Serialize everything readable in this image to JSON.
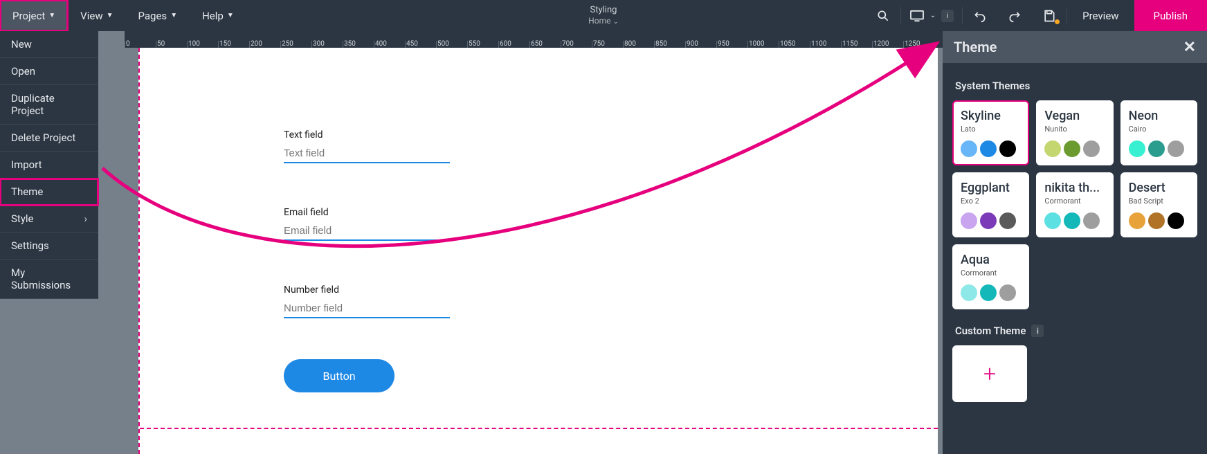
{
  "topbar": {
    "menus": [
      "Project",
      "View",
      "Pages",
      "Help"
    ],
    "title": "Styling",
    "subtitle": "Home",
    "preview": "Preview",
    "publish": "Publish"
  },
  "dropdown": {
    "items": [
      {
        "label": "New",
        "submenu": false
      },
      {
        "label": "Open",
        "submenu": false
      },
      {
        "label": "Duplicate Project",
        "submenu": false
      },
      {
        "label": "Delete Project",
        "submenu": false
      },
      {
        "label": "Import",
        "submenu": false
      },
      {
        "label": "Theme",
        "submenu": false,
        "highlighted": true
      },
      {
        "label": "Style",
        "submenu": true
      },
      {
        "label": "Settings",
        "submenu": false
      },
      {
        "label": "My Submissions",
        "submenu": false
      }
    ]
  },
  "ruler": [
    "0",
    "50",
    "100",
    "150",
    "200",
    "250",
    "300",
    "350",
    "400",
    "450",
    "500",
    "550",
    "600",
    "650",
    "700",
    "750",
    "800",
    "850",
    "900",
    "950",
    "1000",
    "1050",
    "1100",
    "1150",
    "1200",
    "1250"
  ],
  "form": {
    "text_label": "Text field",
    "text_placeholder": "Text field",
    "email_label": "Email field",
    "email_placeholder": "Email field",
    "number_label": "Number field",
    "number_placeholder": "Number field",
    "button_label": "Button"
  },
  "theme_panel": {
    "title": "Theme",
    "system_title": "System Themes",
    "custom_title": "Custom Theme",
    "themes": [
      {
        "name": "Skyline",
        "font": "Lato",
        "colors": [
          "#68b6f7",
          "#1e88e5",
          "#000000"
        ],
        "selected": true
      },
      {
        "name": "Vegan",
        "font": "Nunito",
        "colors": [
          "#c4d66f",
          "#6b9b2f",
          "#9e9e9e"
        ]
      },
      {
        "name": "Neon",
        "font": "Cairo",
        "colors": [
          "#37f0d1",
          "#2a9d8f",
          "#9e9e9e"
        ]
      },
      {
        "name": "Eggplant",
        "font": "Exo 2",
        "colors": [
          "#c9a5f0",
          "#7b3ab8",
          "#5a5a5a"
        ]
      },
      {
        "name": "nikita th...",
        "font": "Cormorant",
        "colors": [
          "#5ce0e2",
          "#14b8b8",
          "#9e9e9e"
        ]
      },
      {
        "name": "Desert",
        "font": "Bad Script",
        "colors": [
          "#e8a23a",
          "#b07327",
          "#000000"
        ]
      },
      {
        "name": "Aqua",
        "font": "Cormorant",
        "colors": [
          "#8fe8e8",
          "#14b8b8",
          "#9e9e9e"
        ]
      }
    ]
  }
}
